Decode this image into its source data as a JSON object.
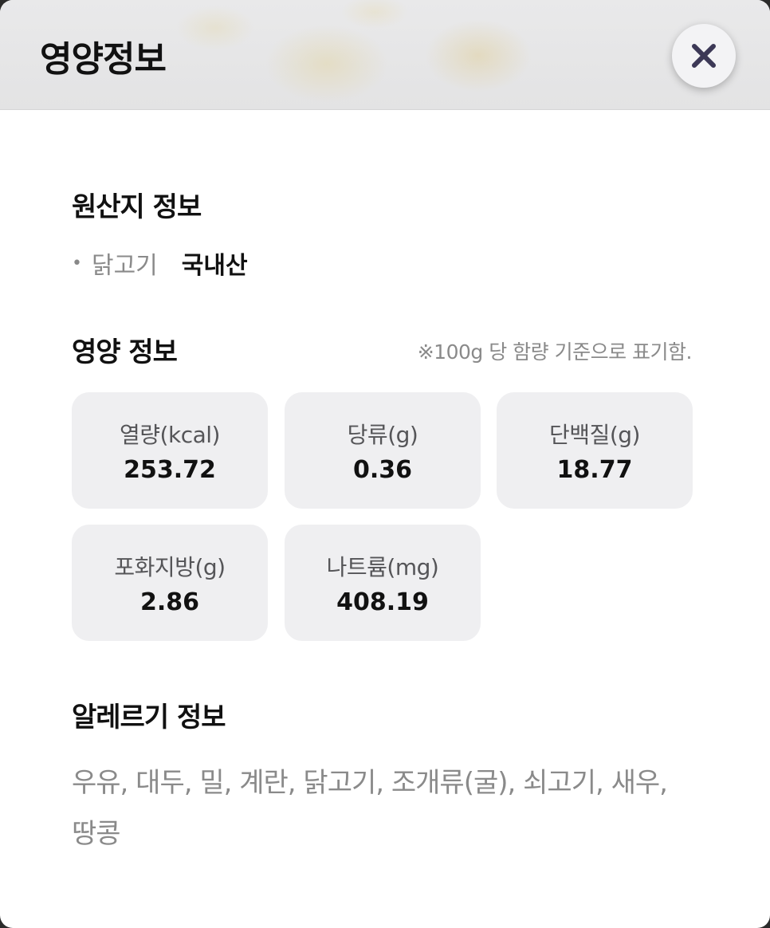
{
  "modal": {
    "title": "영양정보",
    "close_icon": "close-icon"
  },
  "origin": {
    "title": "원산지 정보",
    "bullet": "•",
    "items": [
      {
        "label": "닭고기",
        "value": "국내산"
      }
    ]
  },
  "nutrition": {
    "title": "영양 정보",
    "note": "※100g 당 함량 기준으로 표기함.",
    "items": [
      {
        "label": "열량(kcal)",
        "value": "253.72"
      },
      {
        "label": "당류(g)",
        "value": "0.36"
      },
      {
        "label": "단백질(g)",
        "value": "18.77"
      },
      {
        "label": "포화지방(g)",
        "value": "2.86"
      },
      {
        "label": "나트륨(mg)",
        "value": "408.19"
      }
    ]
  },
  "allergy": {
    "title": "알레르기 정보",
    "text": "우유, 대두, 밀, 계란, 닭고기, 조개류(굴), 쇠고기, 새우, 땅콩"
  },
  "colors": {
    "close_icon": "#3c3856",
    "card_bg": "#efeff1"
  }
}
